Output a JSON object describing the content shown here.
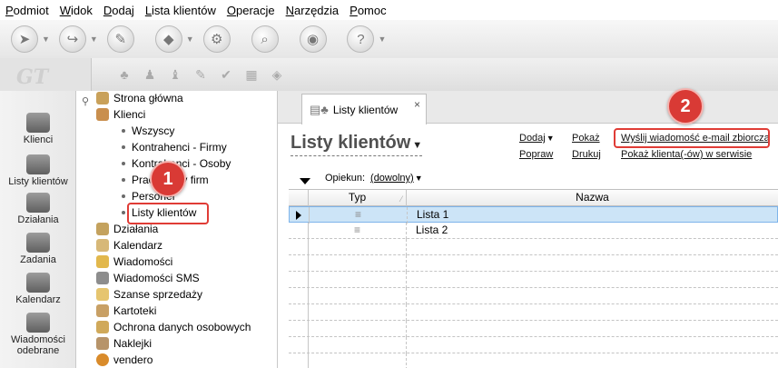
{
  "menu": [
    "Podmiot",
    "Widok",
    "Dodaj",
    "Lista klientów",
    "Operacje",
    "Narzędzia",
    "Pomoc"
  ],
  "logo": "GT",
  "left_nav": [
    {
      "label": "Klienci",
      "icon": "clients-icon"
    },
    {
      "label": "Listy klientów",
      "icon": "client-lists-icon"
    },
    {
      "label": "Działania",
      "icon": "actions-icon"
    },
    {
      "label": "Zadania",
      "icon": "tasks-icon"
    },
    {
      "label": "Kalendarz",
      "icon": "calendar-icon"
    },
    {
      "label": "Wiadomości",
      "label2": "odebrane",
      "icon": "inbox-icon"
    }
  ],
  "tree": {
    "items": [
      {
        "label": "Strona główna",
        "icon": "home-icon",
        "color": "#c9a15a"
      },
      {
        "label": "Klienci",
        "icon": "clients-icon",
        "color": "#c98f4e"
      },
      {
        "label": "Wszyscy",
        "child": true
      },
      {
        "label": "Kontrahenci - Firmy",
        "child": true
      },
      {
        "label": "Kontrahenci - Osoby",
        "child": true
      },
      {
        "label": "Pracownicy firm",
        "child": true
      },
      {
        "label": "Personel",
        "child": true
      },
      {
        "label": "Listy klientów",
        "child": true
      },
      {
        "label": "Działania",
        "icon": "actions-icon",
        "color": "#c4a25e"
      },
      {
        "label": "Kalendarz",
        "icon": "calendar-icon",
        "color": "#d7b878"
      },
      {
        "label": "Wiadomości",
        "icon": "messages-icon",
        "color": "#e2b84c"
      },
      {
        "label": "Wiadomości SMS",
        "icon": "sms-icon",
        "color": "#8d8d8d"
      },
      {
        "label": "Szanse sprzedaży",
        "icon": "sales-icon",
        "color": "#e6c56f"
      },
      {
        "label": "Kartoteki",
        "icon": "files-icon",
        "color": "#c8a065"
      },
      {
        "label": "Ochrona danych osobowych",
        "icon": "shield-icon",
        "color": "#d0a95a"
      },
      {
        "label": "Naklejki",
        "icon": "stickers-icon",
        "color": "#b7946a"
      },
      {
        "label": "vendero",
        "icon": "vendero-icon",
        "color": "#d98b2b"
      }
    ]
  },
  "tab": {
    "label": "Listy klientów",
    "close": "×"
  },
  "page_title": "Listy klientów",
  "actions": {
    "dodaj": "Dodaj",
    "pokaz": "Pokaż",
    "popraw": "Popraw",
    "drukuj": "Drukuj",
    "email": "Wyślij wiadomość e-mail zbiorcza",
    "serwis": "Pokaż klienta(-ów) w serwisie"
  },
  "filter": {
    "label": "Opiekun:",
    "value": "(dowolny)"
  },
  "grid": {
    "columns": [
      "Typ",
      "Nazwa"
    ],
    "rows": [
      {
        "type": "≡",
        "name": "Lista 1",
        "selected": true
      },
      {
        "type": "≡",
        "name": "Lista 2",
        "selected": false
      }
    ]
  },
  "callouts": [
    "1",
    "2"
  ],
  "colors": {
    "callout": "#d93a35",
    "selection": "#cce4f7"
  }
}
